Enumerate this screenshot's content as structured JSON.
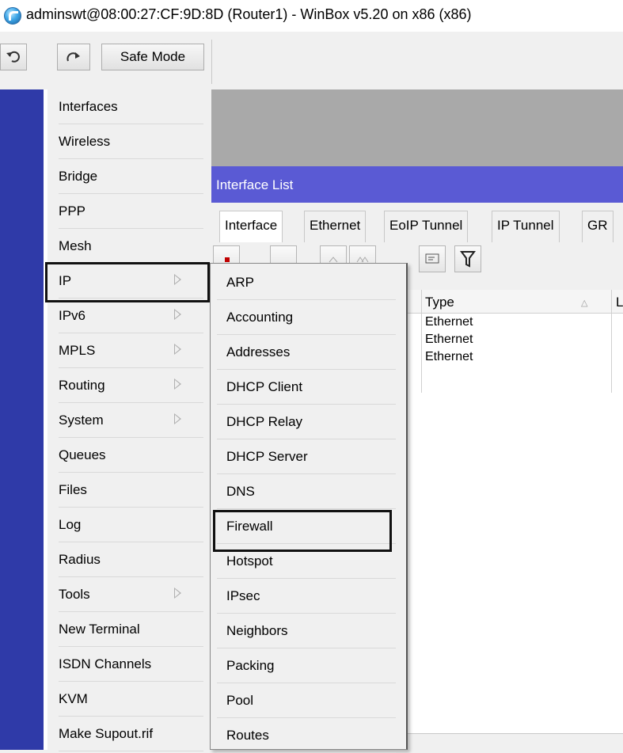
{
  "window": {
    "title": "adminswt@08:00:27:CF:9D:8D (Router1) - WinBox v5.20 on x86 (x86)"
  },
  "toolbar": {
    "undo_icon": "undo-icon",
    "redo_icon": "redo-icon",
    "safe_mode_label": "Safe Mode"
  },
  "menu": {
    "items": [
      {
        "label": "Interfaces"
      },
      {
        "label": "Wireless"
      },
      {
        "label": "Bridge"
      },
      {
        "label": "PPP"
      },
      {
        "label": "Mesh"
      },
      {
        "label": "IP",
        "submenu": true,
        "highlighted": true
      },
      {
        "label": "IPv6",
        "submenu": true
      },
      {
        "label": "MPLS",
        "submenu": true
      },
      {
        "label": "Routing",
        "submenu": true
      },
      {
        "label": "System",
        "submenu": true
      },
      {
        "label": "Queues"
      },
      {
        "label": "Files"
      },
      {
        "label": "Log"
      },
      {
        "label": "Radius"
      },
      {
        "label": "Tools",
        "submenu": true
      },
      {
        "label": "New Terminal"
      },
      {
        "label": "ISDN Channels"
      },
      {
        "label": "KVM"
      },
      {
        "label": "Make Supout.rif"
      }
    ]
  },
  "submenu": {
    "items": [
      {
        "label": "ARP"
      },
      {
        "label": "Accounting"
      },
      {
        "label": "Addresses"
      },
      {
        "label": "DHCP Client"
      },
      {
        "label": "DHCP Relay"
      },
      {
        "label": "DHCP Server"
      },
      {
        "label": "DNS"
      },
      {
        "label": "Firewall",
        "highlighted": true
      },
      {
        "label": "Hotspot"
      },
      {
        "label": "IPsec"
      },
      {
        "label": "Neighbors"
      },
      {
        "label": "Packing"
      },
      {
        "label": "Pool"
      },
      {
        "label": "Routes"
      }
    ]
  },
  "interface_list": {
    "title": "Interface List",
    "tabs": [
      "Interface",
      "Ethernet",
      "EoIP Tunnel",
      "IP Tunnel",
      "GR"
    ],
    "columns": {
      "type": "Type",
      "next": "L"
    },
    "rows": [
      {
        "type": "Ethernet"
      },
      {
        "type": "Ethernet"
      },
      {
        "type": "Ethernet"
      }
    ]
  },
  "colors": {
    "sidebar": "#2f3aa8",
    "list_title_bar": "#5a5ad4",
    "workspace": "#a9a9a9"
  }
}
